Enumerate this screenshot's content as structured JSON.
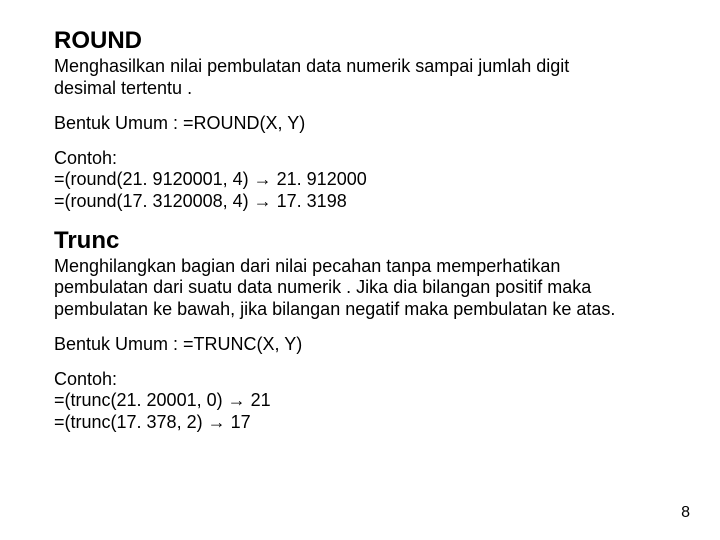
{
  "round": {
    "title": "ROUND",
    "desc1": "Menghasilkan nilai pembulatan data numerik sampai jumlah digit",
    "desc2": "desimal tertentu .",
    "syntax": "Bentuk Umum : =ROUND(X, Y)",
    "example_label": "Contoh:",
    "ex1": "=(round(21. 9120001, 4)  →  21. 912000",
    "ex2": "=(round(17. 3120008, 4)  →  17. 3198"
  },
  "trunc": {
    "title": "Trunc",
    "desc1": "Menghilangkan bagian dari nilai pecahan tanpa memperhatikan",
    "desc2": "pembulatan dari suatu data numerik . Jika dia bilangan positif maka",
    "desc3": "pembulatan ke bawah, jika bilangan negatif maka pembulatan ke atas.",
    "syntax": "Bentuk Umum : =TRUNC(X, Y)",
    "example_label": "Contoh:",
    "ex1": "=(trunc(21. 20001, 0)  →  21",
    "ex2": "=(trunc(17. 378, 2)     →  17"
  },
  "page_number": "8"
}
